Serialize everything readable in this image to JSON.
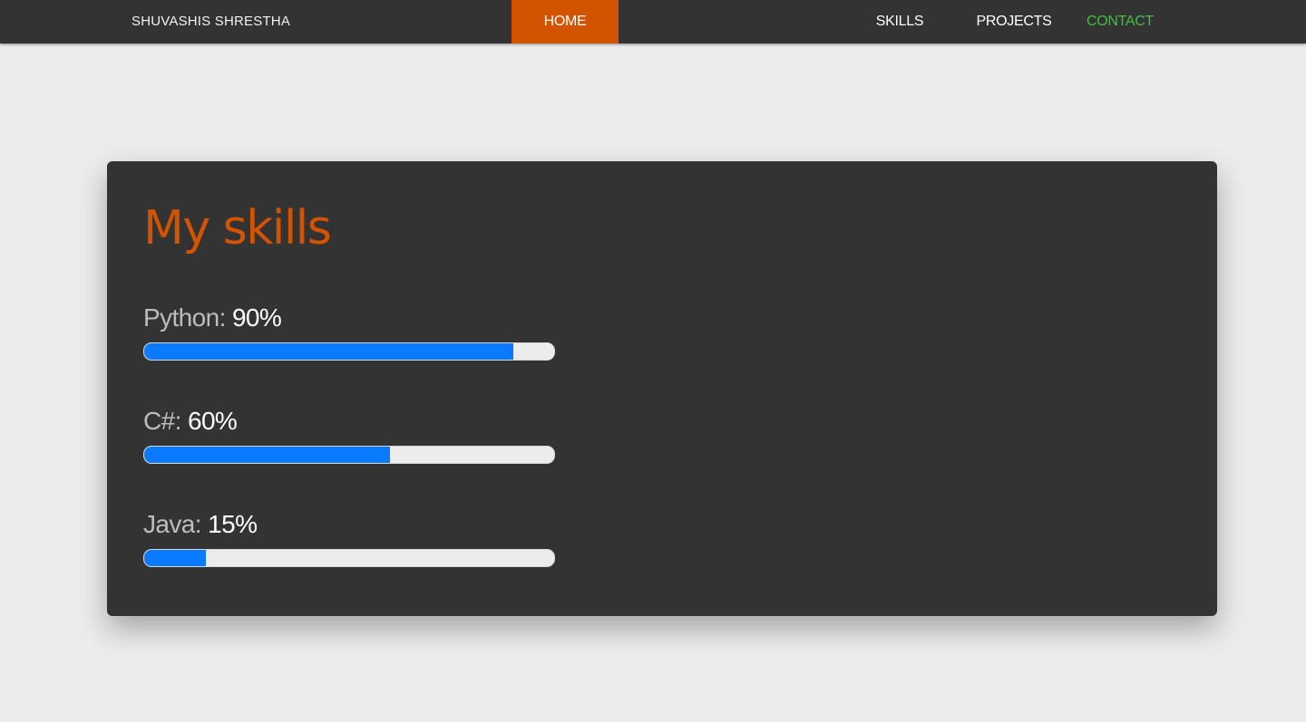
{
  "nav": {
    "brand": "SHUVASHIS SHRESTHA",
    "home": "HOME",
    "skills": "SKILLS",
    "projects": "PROJECTS",
    "contact": "CONTACT"
  },
  "colors": {
    "nav_bg": "#333333",
    "active_tab": "#d35400",
    "contact_link": "#3fbf3f",
    "title": "#d35400",
    "bar_fill": "#0a7bff",
    "bar_track": "#ececec"
  },
  "skills_card": {
    "title": "My skills",
    "skills": [
      {
        "name": "Python:",
        "percent_label": "90%",
        "progress": 90
      },
      {
        "name": "C#:",
        "percent_label": "60%",
        "progress": 60
      },
      {
        "name": "Java:",
        "percent_label": "15%",
        "progress": 15
      }
    ]
  }
}
